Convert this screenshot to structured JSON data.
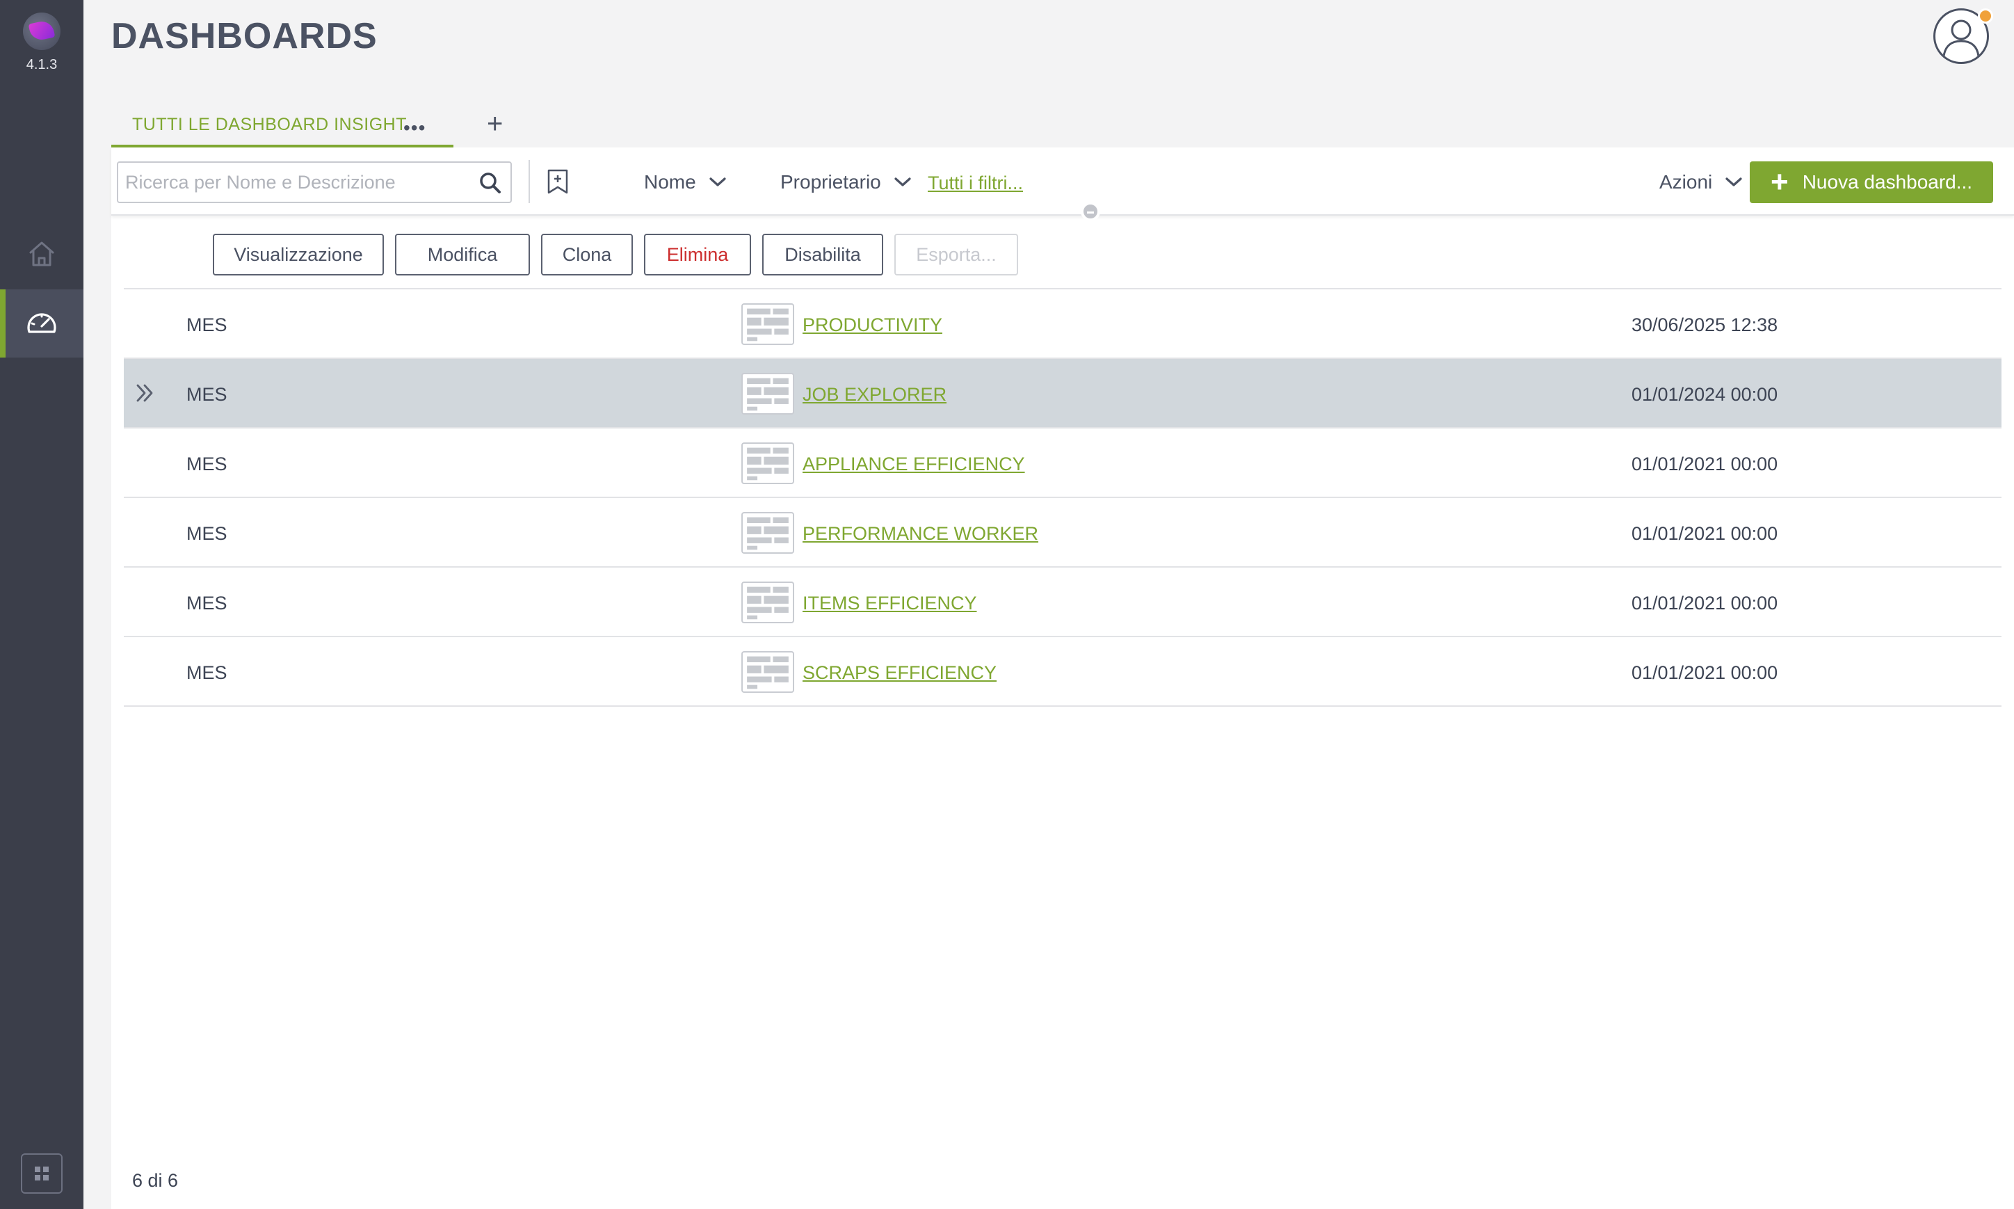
{
  "app": {
    "version": "4.1.3",
    "accent_color": "#7fa731",
    "danger_color": "#cc2e2e",
    "sidebar_color": "#3b3e4a"
  },
  "sidebar": {
    "items": [
      {
        "name": "home",
        "icon": "home-icon",
        "active": false
      },
      {
        "name": "dashboards",
        "icon": "dashboard-icon",
        "active": true
      }
    ],
    "bottom_icon": "grid-icon"
  },
  "header": {
    "title": "DASHBOARDS"
  },
  "tabs": {
    "items": [
      {
        "label": "TUTTI LE DASHBOARD INSIGHT",
        "active": true
      }
    ],
    "more_label": "•••",
    "add_label": "+"
  },
  "toolbar": {
    "search": {
      "placeholder": "Ricerca per Nome e Descrizione",
      "value": ""
    },
    "sort_name_label": "Nome",
    "owner_label": "Proprietario",
    "all_filters_label": "Tutti i filtri...",
    "actions_label": "Azioni",
    "new_dashboard_label": "Nuova dashboard...",
    "new_dashboard_plus": "+"
  },
  "row_actions": {
    "view": "Visualizzazione",
    "edit": "Modifica",
    "clone": "Clona",
    "delete": "Elimina",
    "disable": "Disabilita",
    "export": "Esporta..."
  },
  "table": {
    "rows": [
      {
        "category": "MES",
        "name": "PRODUCTIVITY",
        "date": "30/06/2025 12:38",
        "selected": false
      },
      {
        "category": "MES",
        "name": "JOB EXPLORER",
        "date": "01/01/2024 00:00",
        "selected": true
      },
      {
        "category": "MES",
        "name": "APPLIANCE EFFICIENCY",
        "date": "01/01/2021 00:00",
        "selected": false
      },
      {
        "category": "MES",
        "name": "PERFORMANCE WORKER",
        "date": "01/01/2021 00:00",
        "selected": false
      },
      {
        "category": "MES",
        "name": "ITEMS EFFICIENCY",
        "date": "01/01/2021 00:00",
        "selected": false
      },
      {
        "category": "MES",
        "name": "SCRAPS EFFICIENCY",
        "date": "01/01/2021 00:00",
        "selected": false
      }
    ]
  },
  "footer": {
    "count_label": "6 di 6"
  }
}
